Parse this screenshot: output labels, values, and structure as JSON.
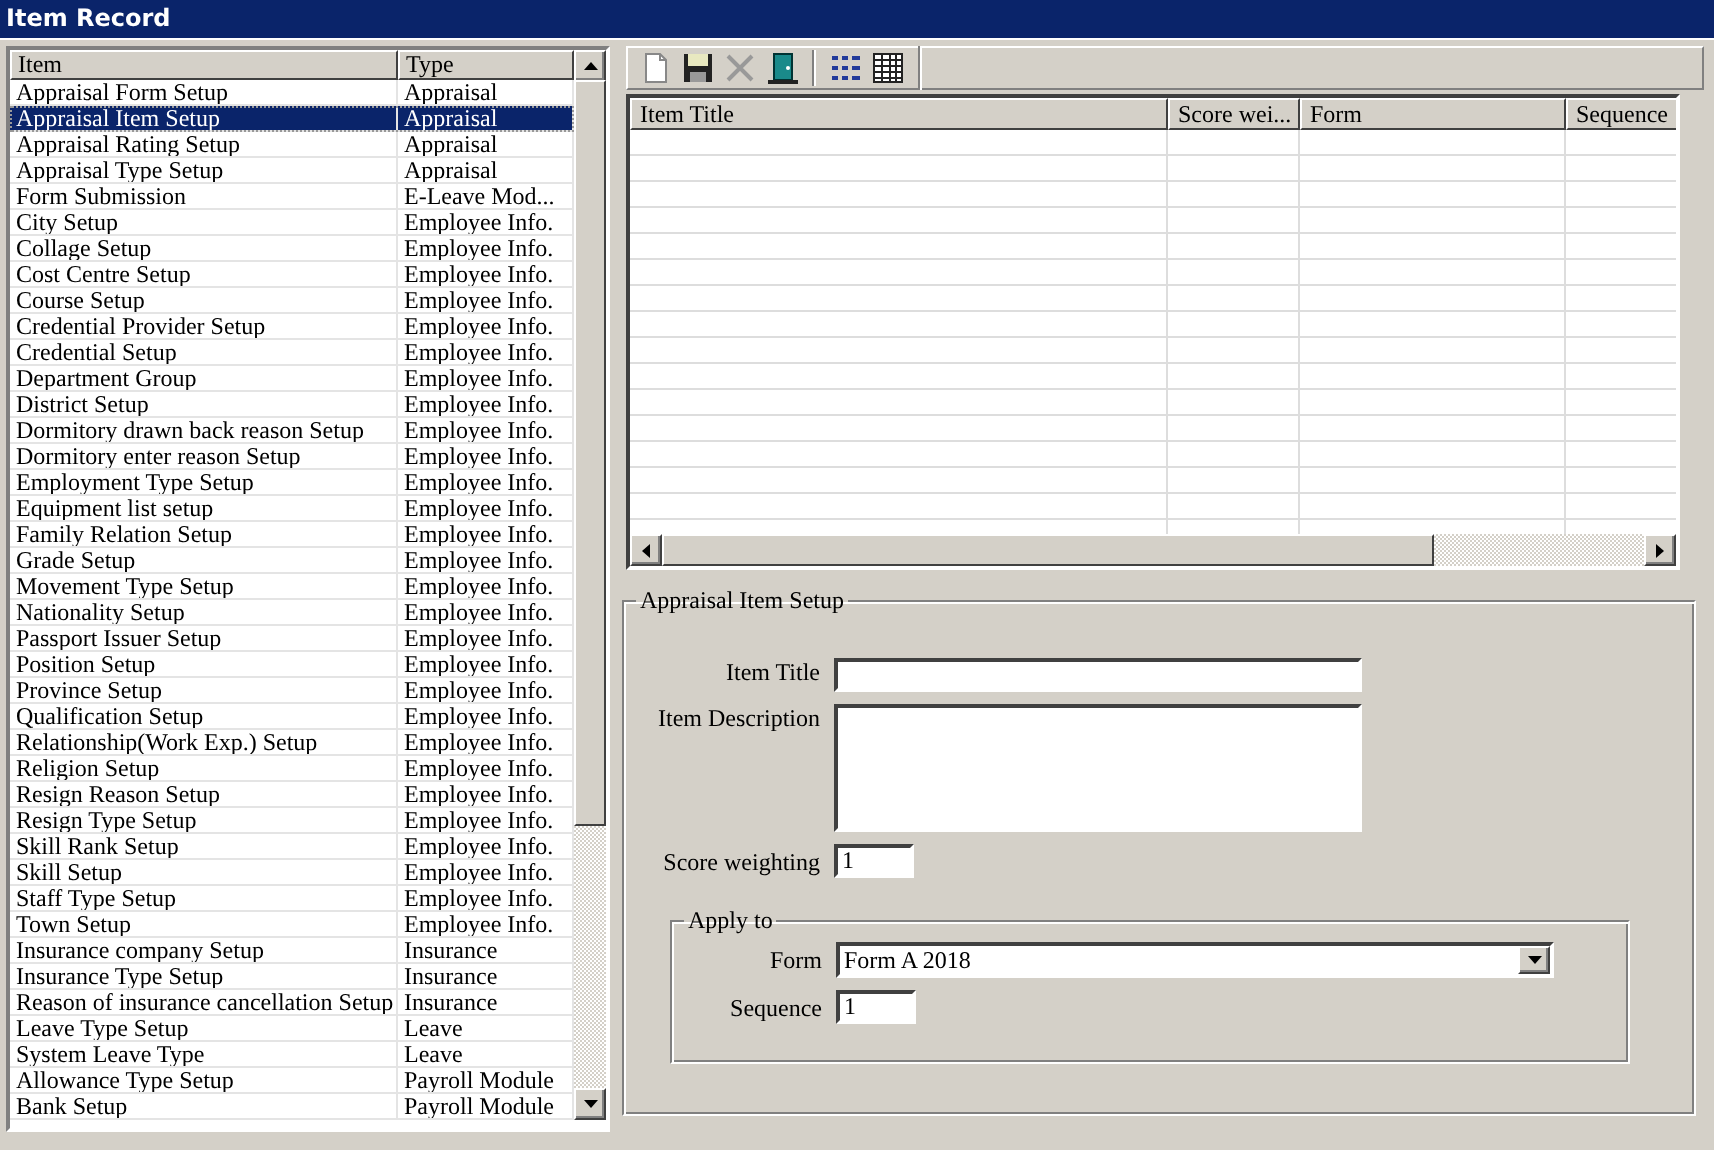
{
  "window": {
    "title": "Item Record"
  },
  "item_list": {
    "columns": [
      "Item",
      "Type"
    ],
    "rows": [
      {
        "item": "Appraisal Form Setup",
        "type": "Appraisal",
        "selected": false
      },
      {
        "item": "Appraisal Item Setup",
        "type": "Appraisal",
        "selected": true
      },
      {
        "item": "Appraisal Rating Setup",
        "type": "Appraisal",
        "selected": false
      },
      {
        "item": "Appraisal Type Setup",
        "type": "Appraisal",
        "selected": false
      },
      {
        "item": "Form Submission",
        "type": "E-Leave Mod...",
        "selected": false
      },
      {
        "item": "City Setup",
        "type": "Employee Info.",
        "selected": false
      },
      {
        "item": "Collage Setup",
        "type": "Employee Info.",
        "selected": false
      },
      {
        "item": "Cost Centre Setup",
        "type": "Employee Info.",
        "selected": false
      },
      {
        "item": "Course Setup",
        "type": "Employee Info.",
        "selected": false
      },
      {
        "item": "Credential Provider Setup",
        "type": "Employee Info.",
        "selected": false
      },
      {
        "item": "Credential Setup",
        "type": "Employee Info.",
        "selected": false
      },
      {
        "item": "Department Group",
        "type": "Employee Info.",
        "selected": false
      },
      {
        "item": "District Setup",
        "type": "Employee Info.",
        "selected": false
      },
      {
        "item": "Dormitory drawn back reason Setup",
        "type": "Employee Info.",
        "selected": false
      },
      {
        "item": "Dormitory enter reason Setup",
        "type": "Employee Info.",
        "selected": false
      },
      {
        "item": "Employment Type Setup",
        "type": "Employee Info.",
        "selected": false
      },
      {
        "item": "Equipment list setup",
        "type": "Employee Info.",
        "selected": false
      },
      {
        "item": "Family Relation Setup",
        "type": "Employee Info.",
        "selected": false
      },
      {
        "item": "Grade Setup",
        "type": "Employee Info.",
        "selected": false
      },
      {
        "item": "Movement Type Setup",
        "type": "Employee Info.",
        "selected": false
      },
      {
        "item": "Nationality Setup",
        "type": "Employee Info.",
        "selected": false
      },
      {
        "item": "Passport Issuer Setup",
        "type": "Employee Info.",
        "selected": false
      },
      {
        "item": "Position Setup",
        "type": "Employee Info.",
        "selected": false
      },
      {
        "item": "Province Setup",
        "type": "Employee Info.",
        "selected": false
      },
      {
        "item": "Qualification Setup",
        "type": "Employee Info.",
        "selected": false
      },
      {
        "item": "Relationship(Work Exp.) Setup",
        "type": "Employee Info.",
        "selected": false
      },
      {
        "item": "Religion Setup",
        "type": "Employee Info.",
        "selected": false
      },
      {
        "item": "Resign Reason Setup",
        "type": "Employee Info.",
        "selected": false
      },
      {
        "item": "Resign Type Setup",
        "type": "Employee Info.",
        "selected": false
      },
      {
        "item": "Skill Rank Setup",
        "type": "Employee Info.",
        "selected": false
      },
      {
        "item": "Skill Setup",
        "type": "Employee Info.",
        "selected": false
      },
      {
        "item": "Staff Type Setup",
        "type": "Employee Info.",
        "selected": false
      },
      {
        "item": "Town Setup",
        "type": "Employee Info.",
        "selected": false
      },
      {
        "item": "Insurance company Setup",
        "type": "Insurance",
        "selected": false
      },
      {
        "item": "Insurance Type Setup",
        "type": "Insurance",
        "selected": false
      },
      {
        "item": "Reason of insurance cancellation Setup",
        "type": "Insurance",
        "selected": false
      },
      {
        "item": "Leave Type Setup",
        "type": "Leave",
        "selected": false
      },
      {
        "item": "System Leave Type",
        "type": "Leave",
        "selected": false
      },
      {
        "item": "Allowance Type Setup",
        "type": "Payroll Module",
        "selected": false
      },
      {
        "item": "Bank Setup",
        "type": "Payroll Module",
        "selected": false
      }
    ]
  },
  "toolbar": {
    "buttons": [
      {
        "kind": "new"
      },
      {
        "kind": "save"
      },
      {
        "kind": "delete"
      },
      {
        "kind": "exit"
      },
      {
        "kind": "separator"
      },
      {
        "kind": "list"
      },
      {
        "kind": "grid"
      }
    ]
  },
  "grid": {
    "columns": [
      "Item Title",
      "Score wei...",
      "Form",
      "Sequence"
    ]
  },
  "detail": {
    "title": "Appraisal Item Setup",
    "fields": [
      {
        "label": "Item Title",
        "kind": "text"
      },
      {
        "label": "Item Description",
        "kind": "textarea"
      },
      {
        "label": "Score weighting",
        "kind": "number",
        "value": "1"
      }
    ],
    "apply_to": {
      "title": "Apply to",
      "fields": [
        {
          "label": "Form",
          "kind": "select",
          "value": "Form A 2018"
        },
        {
          "label": "Sequence",
          "kind": "number",
          "value": "1"
        }
      ]
    }
  }
}
